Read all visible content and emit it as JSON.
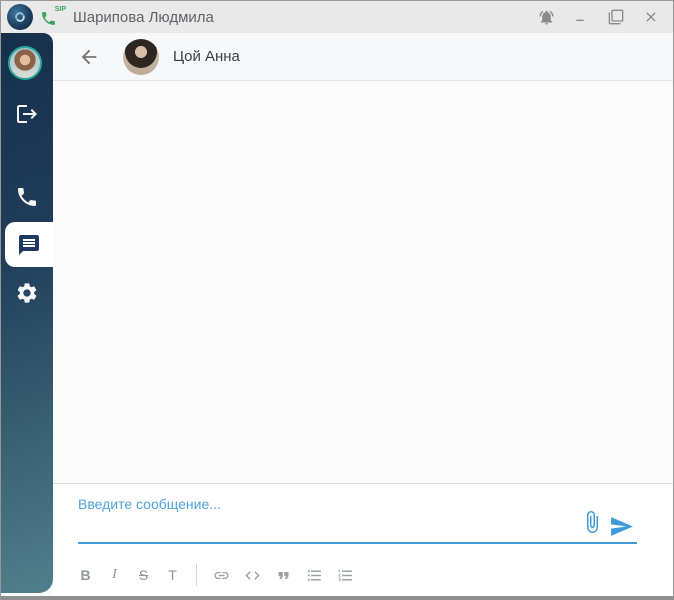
{
  "titlebar": {
    "title": "Шарипова Людмила",
    "sip_label": "SIP",
    "controls": {
      "notifications": "bell-icon",
      "minimize": "minimize-icon",
      "maximize": "maximize-restore-icon",
      "close": "close-icon"
    }
  },
  "sidebar": {
    "items": [
      {
        "id": "profile",
        "icon": "user-avatar"
      },
      {
        "id": "logout",
        "icon": "logout-icon"
      },
      {
        "id": "calls",
        "icon": "phone-icon"
      },
      {
        "id": "chats",
        "icon": "chat-bubble-icon",
        "active": true
      },
      {
        "id": "settings",
        "icon": "gear-icon"
      }
    ]
  },
  "chat": {
    "contact_name": "Цой Анна",
    "messages": []
  },
  "composer": {
    "placeholder": "Введите сообщение...",
    "toolbar": [
      {
        "id": "bold",
        "label": "B"
      },
      {
        "id": "italic",
        "label": "I"
      },
      {
        "id": "strikethrough",
        "label": "S"
      },
      {
        "id": "text-format",
        "label": "T"
      },
      {
        "id": "link",
        "icon": "link-icon"
      },
      {
        "id": "code",
        "icon": "code-icon"
      },
      {
        "id": "quote",
        "icon": "quote-icon"
      },
      {
        "id": "bullet-list",
        "icon": "bullet-list-icon"
      },
      {
        "id": "numbered-list",
        "icon": "numbered-list-icon"
      }
    ],
    "actions": {
      "attach": "paperclip-icon",
      "send": "send-icon"
    }
  },
  "colors": {
    "accent_blue": "#3f9bd8",
    "placeholder_blue": "#4ea3dc",
    "sidebar_gradient_top": "#16304c",
    "sidebar_gradient_bottom": "#527f8d",
    "titlebar_bg": "#e9e9e9",
    "sip_green": "#3aa65a",
    "active_item_bg": "#ffffff"
  }
}
